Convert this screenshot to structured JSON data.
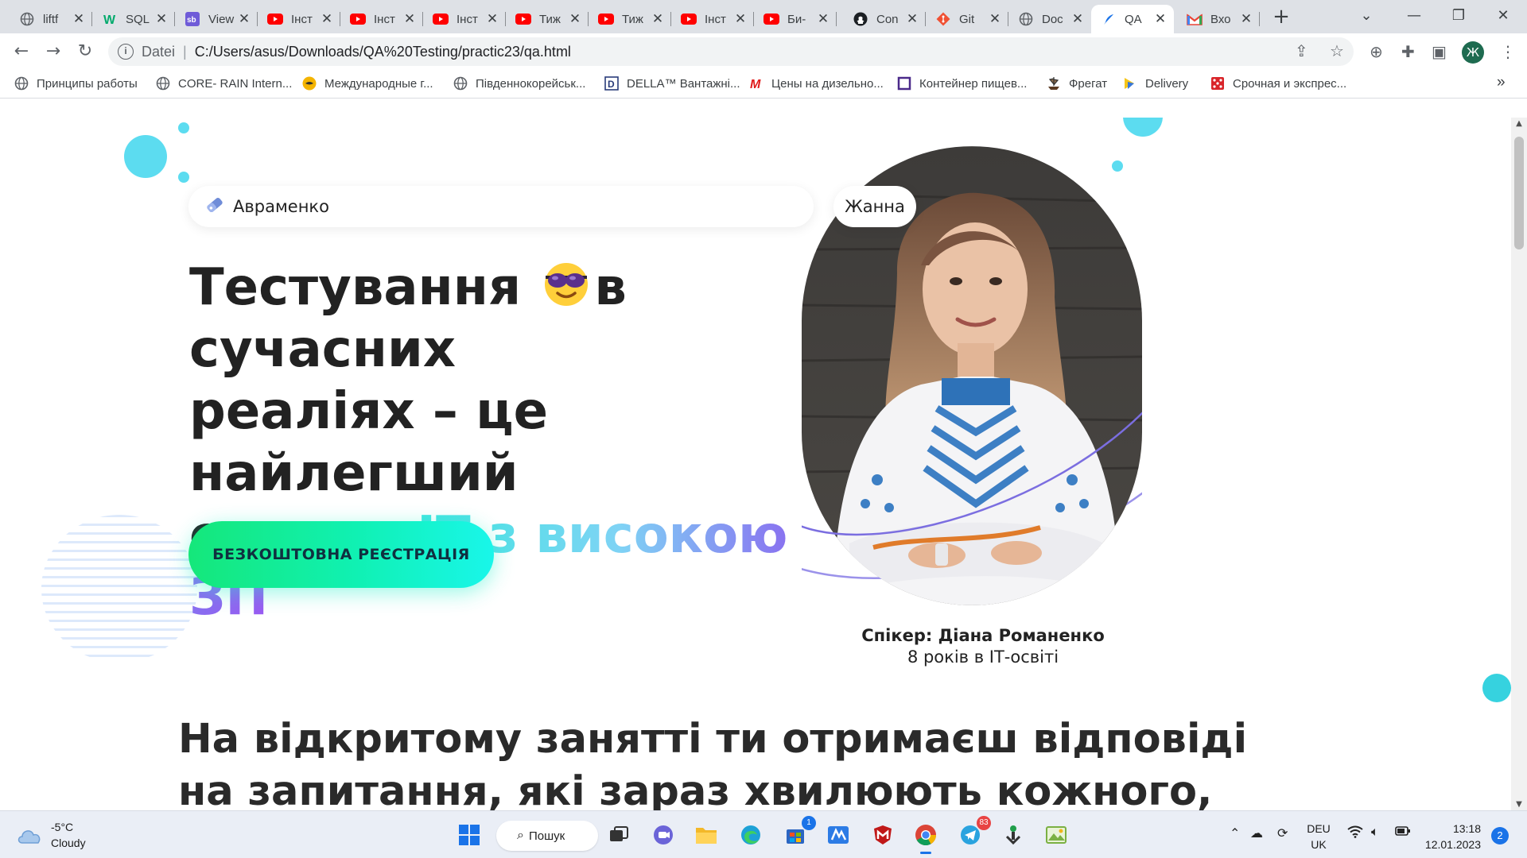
{
  "browser": {
    "tabs": [
      {
        "title": "liftf",
        "icon": "globe-icon",
        "active": false
      },
      {
        "title": "SQL",
        "icon": "w3schools-icon",
        "active": false
      },
      {
        "title": "View",
        "icon": "sb-icon",
        "active": false
      },
      {
        "title": "Інст",
        "icon": "youtube-icon",
        "active": false
      },
      {
        "title": "Інст",
        "icon": "youtube-icon",
        "active": false
      },
      {
        "title": "Інст",
        "icon": "youtube-icon",
        "active": false
      },
      {
        "title": "Тиж",
        "icon": "youtube-icon",
        "active": false
      },
      {
        "title": "Тиж",
        "icon": "youtube-icon",
        "active": false
      },
      {
        "title": "Інст",
        "icon": "youtube-icon",
        "active": false
      },
      {
        "title": "Би-",
        "icon": "youtube-icon",
        "active": false
      },
      {
        "title": "Con",
        "icon": "github-icon",
        "active": false
      },
      {
        "title": "Git",
        "icon": "git-icon",
        "active": false
      },
      {
        "title": "Doc",
        "icon": "globe-icon",
        "active": false
      },
      {
        "title": "QA",
        "icon": "feather-icon",
        "active": true
      },
      {
        "title": "Вхо",
        "icon": "gmail-icon",
        "active": false
      }
    ],
    "address": {
      "scheme_label": "Datei",
      "url": "C:/Users/asus/Downloads/QA%20Testing/practic23/qa.html"
    },
    "profile_initial": "Ж",
    "bookmarks": [
      {
        "label": "Принципы работы",
        "icon": "globe-icon"
      },
      {
        "label": "CORE- RAIN Intern...",
        "icon": "globe-icon"
      },
      {
        "label": "Международные г...",
        "icon": "handshake-icon"
      },
      {
        "label": "Південнокорейськ...",
        "icon": "globe-icon"
      },
      {
        "label": "DELLA™ Вантажні...",
        "icon": "della-icon"
      },
      {
        "label": "Цены на дизельно...",
        "icon": "m-logo-icon"
      },
      {
        "label": "Контейнер пищев...",
        "icon": "square-icon"
      },
      {
        "label": "Фрегат",
        "icon": "ship-icon"
      },
      {
        "label": "Delivery",
        "icon": "delivery-icon"
      },
      {
        "label": "Срочная и экспрес...",
        "icon": "dice-icon"
      }
    ],
    "bookmarks_more": "»"
  },
  "page": {
    "last_name_value": "Авраменко",
    "first_name_value": "Жанна",
    "headline": {
      "line1_before": "Тестування ",
      "line1_after": "в сучасних",
      "line2": "реаліях – це найлегший",
      "line3_plain": "старт в ",
      "line3_gradient": "ІТ з високою ЗП"
    },
    "cta_label": "БЕЗКОШТОВНА РЕЄСТРАЦІЯ",
    "speaker_name": "Спікер: Діана Романенко",
    "speaker_experience": "8 років в ІТ-освіті",
    "subheading_line1": "На відкритому занятті ти отримаєш відповіді",
    "subheading_line2": "на запитання, які зараз хвилюють кожного,",
    "colors": {
      "accent_cyan": "#5cdcf0",
      "cta_gradient_start": "#15e77a",
      "cta_gradient_end": "#19f6ea",
      "orbit_purple": "#7b6ee0",
      "gradient_purple": "#9b59f2"
    }
  },
  "taskbar": {
    "weather_temp": "-5°C",
    "weather_desc": "Cloudy",
    "search_label": "Пошук",
    "apps": [
      {
        "name": "start-icon"
      },
      {
        "name": "task-view-icon"
      },
      {
        "name": "chat-icon"
      },
      {
        "name": "file-explorer-icon"
      },
      {
        "name": "edge-icon"
      },
      {
        "name": "store-icon",
        "badge": "1"
      },
      {
        "name": "maps-icon"
      },
      {
        "name": "mcafee-icon"
      },
      {
        "name": "chrome-icon",
        "active": true
      },
      {
        "name": "telegram-icon",
        "badge": "83"
      },
      {
        "name": "transfer-icon"
      },
      {
        "name": "photos-icon"
      }
    ],
    "language_line1": "DEU",
    "language_line2": "UK",
    "time": "13:18",
    "date": "12.01.2023",
    "notification_count": "2"
  }
}
